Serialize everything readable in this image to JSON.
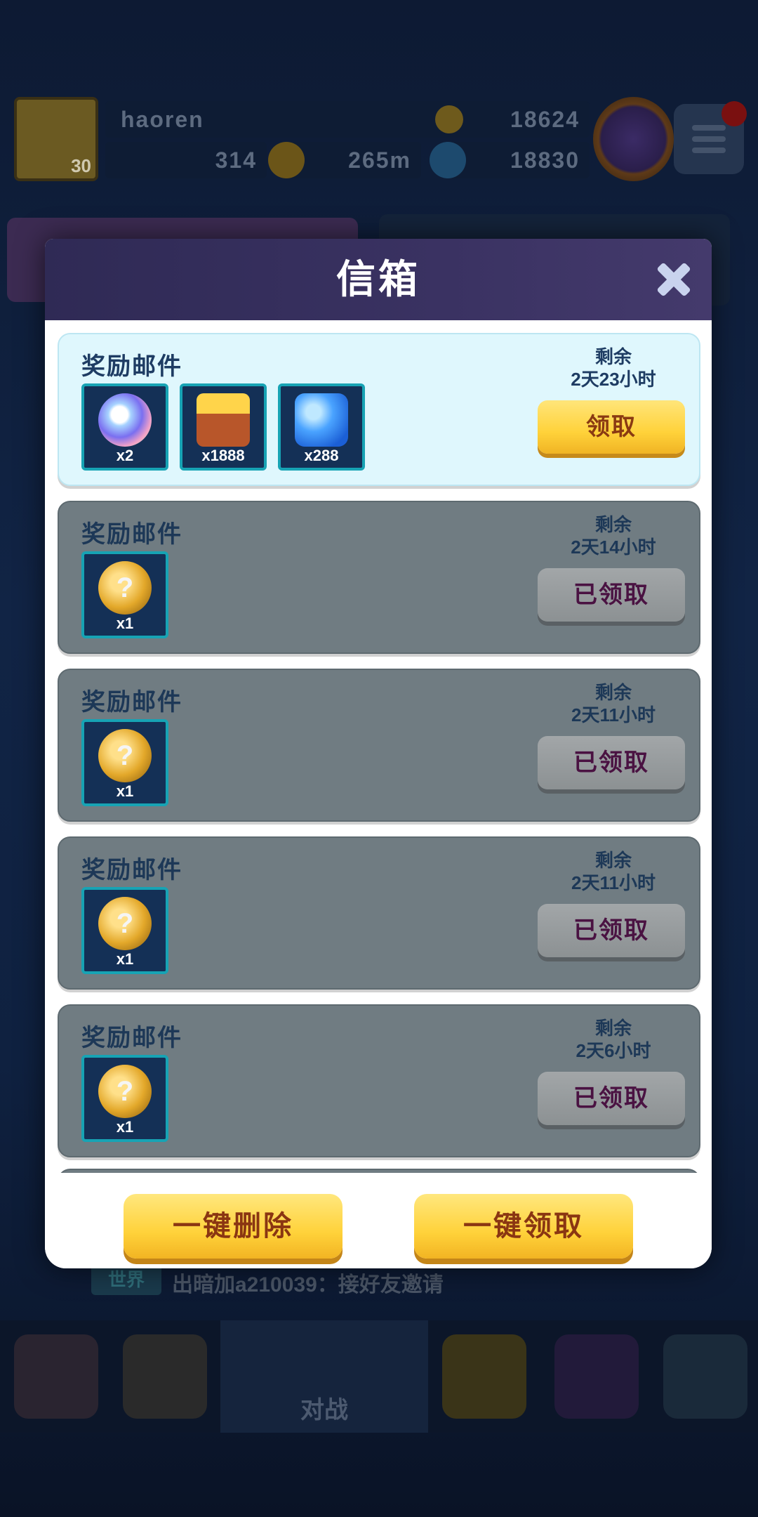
{
  "background": {
    "player_name": "haoren",
    "player_level": "30",
    "trophies": "18624",
    "currency_1": "314",
    "currency_2": "265m",
    "currency_3": "18830",
    "chat_channel": "世界",
    "chat_message": "出暗加a210039：接好友邀请",
    "nav_battle_label": "对战"
  },
  "dialog": {
    "title": "信箱",
    "close_icon": "close-icon",
    "remain_label": "剩余",
    "mails": [
      {
        "title": "奖励邮件",
        "remaining": "2天23小时",
        "button": "领取",
        "claimed": false,
        "items": [
          {
            "icon": "ticket-icon",
            "qty": "x2"
          },
          {
            "icon": "treasure-chest-icon",
            "qty": "x1888"
          },
          {
            "icon": "blue-gem-icon",
            "qty": "x288"
          }
        ]
      },
      {
        "title": "奖励邮件",
        "remaining": "2天14小时",
        "button": "已领取",
        "claimed": true,
        "items": [
          {
            "icon": "mystery-coin-icon",
            "qty": "x1"
          }
        ]
      },
      {
        "title": "奖励邮件",
        "remaining": "2天11小时",
        "button": "已领取",
        "claimed": true,
        "items": [
          {
            "icon": "mystery-coin-icon",
            "qty": "x1"
          }
        ]
      },
      {
        "title": "奖励邮件",
        "remaining": "2天11小时",
        "button": "已领取",
        "claimed": true,
        "items": [
          {
            "icon": "mystery-coin-icon",
            "qty": "x1"
          }
        ]
      },
      {
        "title": "奖励邮件",
        "remaining": "2天6小时",
        "button": "已领取",
        "claimed": true,
        "items": [
          {
            "icon": "mystery-coin-icon",
            "qty": "x1"
          }
        ]
      }
    ],
    "footer": {
      "delete_all": "一键删除",
      "claim_all": "一键领取"
    }
  },
  "colors": {
    "header": "#3a3262",
    "claim_button": "#ffd23a",
    "claimed_button": "#8c9193",
    "new_mail_bg": "#dff7fd",
    "claimed_mail_bg": "#707c82"
  }
}
